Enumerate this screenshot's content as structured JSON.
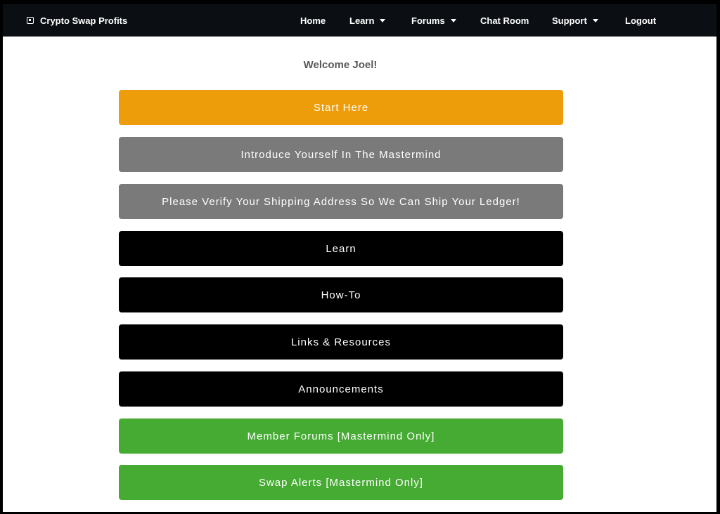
{
  "header": {
    "brand": "Crypto Swap Profits",
    "nav": [
      {
        "label": "Home"
      },
      {
        "label": "Learn"
      },
      {
        "label": "Forums"
      },
      {
        "label": "Chat Room"
      },
      {
        "label": "Support"
      },
      {
        "label": "Logout"
      }
    ]
  },
  "main": {
    "welcome": "Welcome Joel!",
    "buttons": [
      {
        "label": "Start Here",
        "color": "#ed9c0a"
      },
      {
        "label": "Introduce Yourself In The Mastermind",
        "color": "#7b7a7b"
      },
      {
        "label": "Please Verify Your Shipping Address So We Can Ship Your Ledger!",
        "color": "#7b7a7b"
      },
      {
        "label": "Learn",
        "color": "#000000"
      },
      {
        "label": "How-To",
        "color": "#000000"
      },
      {
        "label": "Links & Resources",
        "color": "#000000"
      },
      {
        "label": "Announcements",
        "color": "#000000"
      },
      {
        "label": "Member Forums [Mastermind Only]",
        "color": "#45ab32"
      },
      {
        "label": "Swap Alerts [Mastermind Only]",
        "color": "#45ab32"
      }
    ]
  }
}
